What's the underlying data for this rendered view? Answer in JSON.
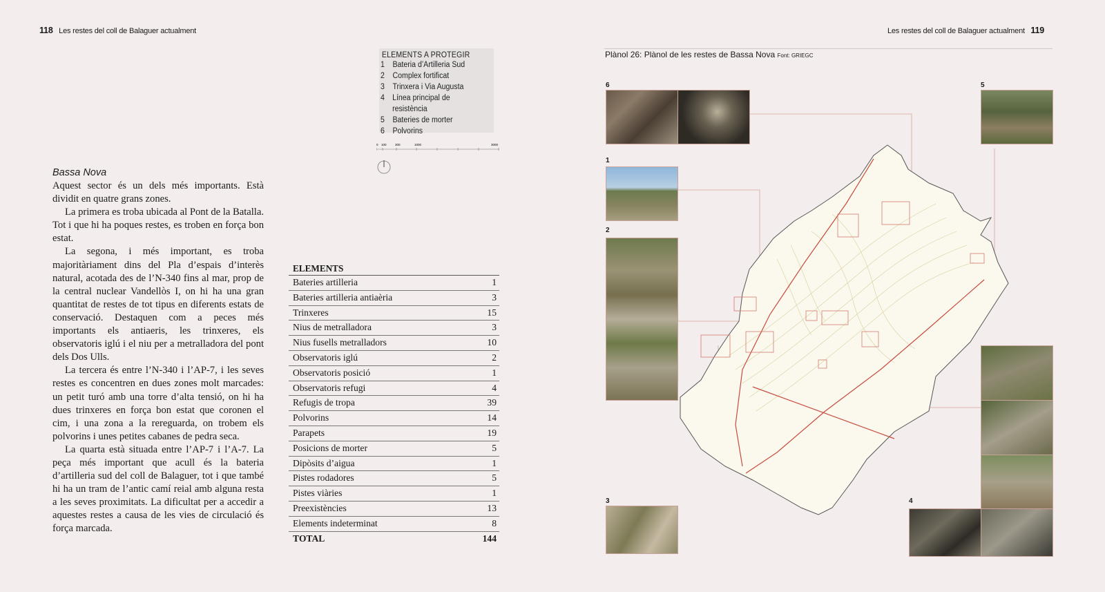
{
  "header": {
    "left_page": "118",
    "left_title": "Les restes del coll de Balaguer actualment",
    "right_title": "Les restes del coll de Balaguer actualment",
    "right_page": "119"
  },
  "legend": {
    "title": "ELEMENTS A PROTEGIR",
    "items": [
      {
        "n": "1",
        "label": "Bateria d’Artilleria Sud"
      },
      {
        "n": "2",
        "label": "Complex fortificat"
      },
      {
        "n": "3",
        "label": "Trinxera i Via Augusta"
      },
      {
        "n": "4",
        "label": "Línea principal de resistència"
      },
      {
        "n": "5",
        "label": "Bateries de morter"
      },
      {
        "n": "6",
        "label": "Polvorins"
      }
    ]
  },
  "scale": {
    "ticks": [
      "0",
      "100",
      "300",
      "1000",
      "3000"
    ]
  },
  "article": {
    "heading": "Bassa Nova",
    "paragraphs": [
      "Aquest sector és un dels més importants. Està dividit en quatre grans zones.",
      "La primera es troba ubicada al Pont de la Batalla. Tot i que hi ha poques restes, es troben en força bon estat.",
      "La segona, i més important, es troba majoritàriament dins del Pla d’espais d’interès natural, acotada des de l’N-340 fins al mar, prop de la central nuclear Vandellòs I, on hi ha una gran quantitat de restes de tot tipus en diferents estats de conservació. Destaquen com a peces més importants els antiaeris, les trinxeres, els observatoris iglú i el niu per a metralladora del pont dels Dos Ulls.",
      "La tercera és entre l’N-340 i l’AP-7, i les seves restes es concentren en dues zones molt marcades: un petit turó amb una torre d’alta tensió, on hi ha dues trinxeres en força bon estat que coronen el cim, i una zona a la rereguarda, on trobem els polvorins i unes petites cabanes de pedra seca.",
      "La quarta està situada entre l’AP-7 i l’A-7. La peça més important que acull és la bateria d’artilleria sud del coll de Balaguer, tot i que també hi ha un tram de l’antic camí reial amb alguna resta a les seves proximitats. La dificultat per a accedir a aquestes restes a causa de les vies de circulació és força marcada."
    ]
  },
  "elements_table": {
    "header": "ELEMENTS",
    "rows": [
      {
        "label": "Bateries artilleria",
        "value": "1"
      },
      {
        "label": "Bateries artilleria antiaèria",
        "value": "3"
      },
      {
        "label": "Trinxeres",
        "value": "15"
      },
      {
        "label": "Nius de metralladora",
        "value": "3"
      },
      {
        "label": "Nius fusells metralladors",
        "value": "10"
      },
      {
        "label": "Observatoris iglú",
        "value": "2"
      },
      {
        "label": "Observatoris posició",
        "value": "1"
      },
      {
        "label": "Observatoris refugi",
        "value": "4"
      },
      {
        "label": "Refugis de tropa",
        "value": "39"
      },
      {
        "label": "Polvorins",
        "value": "14"
      },
      {
        "label": "Parapets",
        "value": "19"
      },
      {
        "label": "Posicions de morter",
        "value": "5"
      },
      {
        "label": "Dipòsits d’aigua",
        "value": "1"
      },
      {
        "label": "Pistes rodadores",
        "value": "5"
      },
      {
        "label": "Pistes viàries",
        "value": "1"
      },
      {
        "label": "Preexistències",
        "value": "13"
      },
      {
        "label": "Elements indeterminat",
        "value": "8"
      }
    ],
    "total_label": "TOTAL",
    "total_value": "144"
  },
  "plan": {
    "title": "Plànol 26: Plànol de les restes de Bassa Nova",
    "source": "Font: GRIEGC",
    "photo_labels": [
      "6",
      "1",
      "2",
      "3",
      "5",
      "4"
    ]
  },
  "colors": {
    "page_bg": "#f3eded",
    "map_line": "#d47a6e",
    "contour": "#c9c28a",
    "legend_bg": "#e6e1e1"
  }
}
